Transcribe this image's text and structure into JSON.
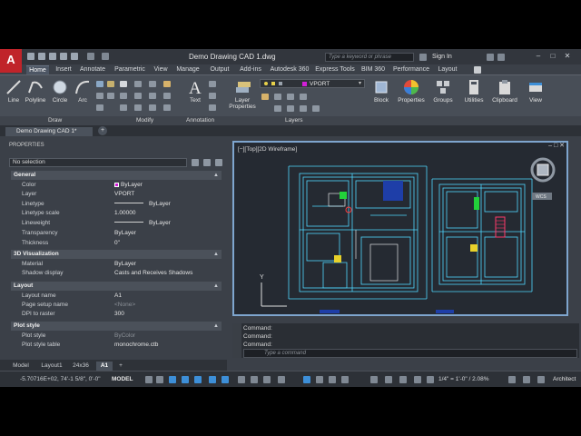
{
  "window": {
    "app_logo": "A",
    "title": "Demo Drawing CAD 1.dwg",
    "search_placeholder": "Type a keyword or phrase",
    "signin": "Sign In"
  },
  "ribbon_tabs": [
    "Home",
    "Insert",
    "Annotate",
    "Parametric",
    "View",
    "Manage",
    "Output",
    "Add-ins",
    "Autodesk 360",
    "Express Tools",
    "BIM 360",
    "Performance",
    "Layout"
  ],
  "active_ribbon_tab": "Home",
  "ribbon": {
    "tools": {
      "line": "Line",
      "polyline": "Polyline",
      "circle": "Circle",
      "arc": "Arc",
      "text": "Text",
      "layer_properties_1": "Layer",
      "layer_properties_2": "Properties",
      "block": "Block",
      "properties": "Properties",
      "groups": "Groups",
      "utilities": "Utilities",
      "clipboard": "Clipboard",
      "view": "View"
    },
    "current_layer": "VPORT",
    "panels": [
      "Draw",
      "Modify",
      "Annotation",
      "Layers"
    ]
  },
  "doc_tab": "Demo Drawing CAD 1*",
  "properties": {
    "title": "PROPERTIES",
    "selection": "No selection",
    "sections": {
      "general": {
        "label": "General",
        "rows": [
          {
            "key": "Color",
            "value": "ByLayer"
          },
          {
            "key": "Layer",
            "value": "VPORT"
          },
          {
            "key": "Linetype",
            "value": "ByLayer"
          },
          {
            "key": "Linetype scale",
            "value": "1.00000"
          },
          {
            "key": "Lineweight",
            "value": "ByLayer"
          },
          {
            "key": "Transparency",
            "value": "ByLayer"
          },
          {
            "key": "Thickness",
            "value": "0\""
          }
        ]
      },
      "visualization": {
        "label": "3D Visualization",
        "rows": [
          {
            "key": "Material",
            "value": "ByLayer"
          },
          {
            "key": "Shadow display",
            "value": "Casts and Receives Shadows"
          }
        ]
      },
      "layout": {
        "label": "Layout",
        "rows": [
          {
            "key": "Layout name",
            "value": "A1"
          },
          {
            "key": "Page setup name",
            "value": "<None>"
          },
          {
            "key": "DPI to raster",
            "value": "300"
          }
        ]
      },
      "plot_style": {
        "label": "Plot style",
        "rows": [
          {
            "key": "Plot style",
            "value": "ByColor"
          },
          {
            "key": "Plot style table",
            "value": "monochrome.ctb"
          }
        ]
      }
    }
  },
  "layout_tabs": [
    "Model",
    "Layout1",
    "24x36",
    "A1"
  ],
  "active_layout_tab": "A1",
  "viewport": {
    "label": "[−][Top][2D Wireframe]",
    "axis_y": "Y",
    "viewcube_label": "WCS"
  },
  "command": {
    "history": [
      "Command:",
      "Command:",
      "Command:"
    ],
    "placeholder": "Type a command"
  },
  "statusbar": {
    "coords": "-5.70716E+02, 74'-1 5/8\", 0'-0\"",
    "model": "MODEL",
    "scale": "1/4\" = 1'-0\" / 2.08%",
    "workspace": "Architect"
  },
  "colors": {
    "accent": "#3d8fd8",
    "logo_red": "#c0242a",
    "drawing_lines": "#4fd8ff",
    "viewport_border": "#7ea5ce"
  }
}
